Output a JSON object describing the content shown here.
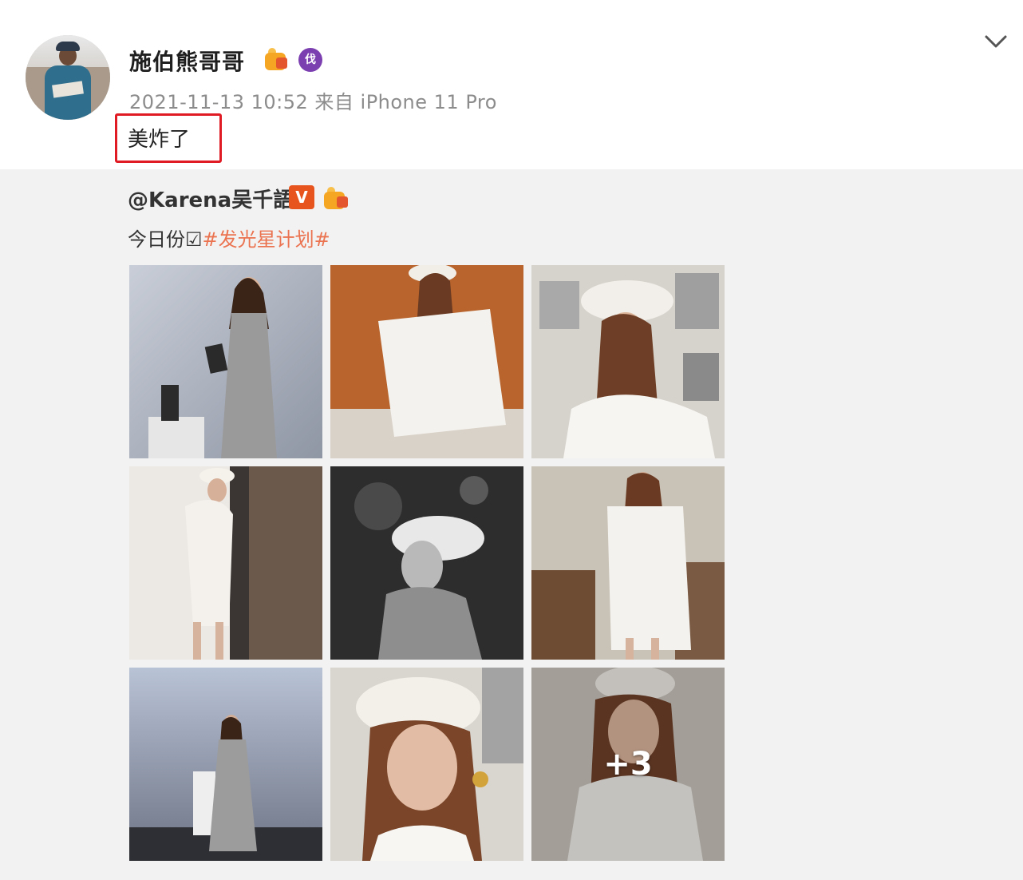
{
  "post": {
    "username": "施伯熊哥哥",
    "timestamp": "2021-11-13 10:52 来自 iPhone 11 Pro",
    "text": "美炸了",
    "vip_badge_text": "伐"
  },
  "repost": {
    "author": "@Karena吴千語",
    "verified_badge": "V",
    "text_prefix": "今日份☑",
    "hashtag": "#发光星计划#"
  },
  "photos": [
    {
      "id": "1",
      "desc": "gray-dress-product"
    },
    {
      "id": "2",
      "desc": "orange-white-coat"
    },
    {
      "id": "3",
      "desc": "beret-window"
    },
    {
      "id": "4",
      "desc": "white-sweater-wall"
    },
    {
      "id": "5",
      "desc": "bw-beret-profile"
    },
    {
      "id": "6",
      "desc": "white-coat-room"
    },
    {
      "id": "7",
      "desc": "silver-gown-stage"
    },
    {
      "id": "8",
      "desc": "beret-closeup"
    },
    {
      "id": "9",
      "desc": "more-photos",
      "overlay": "+3"
    }
  ],
  "colors": {
    "highlight": "#e01b24",
    "hashtag": "#eb7350",
    "repost_bg": "#f2f2f2"
  }
}
